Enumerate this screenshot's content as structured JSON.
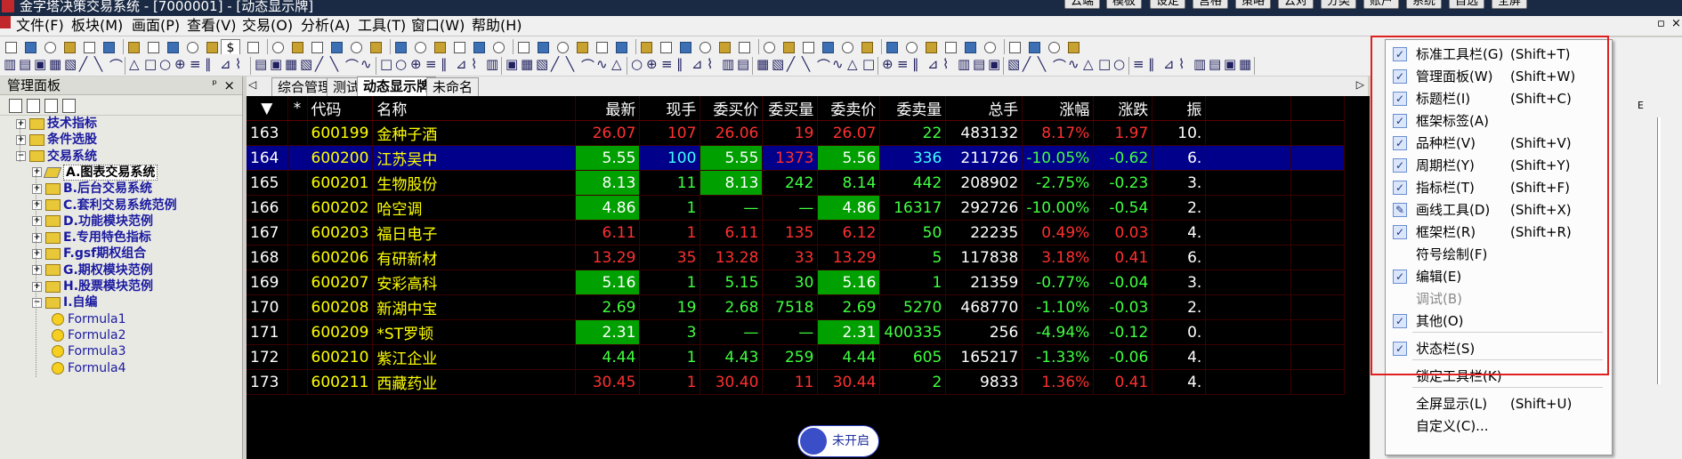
{
  "titlebar": {
    "title": "金字塔决策交易系统 - [7000001] - [动态显示牌]",
    "buttons": [
      "云端",
      "模板",
      "设定",
      "宫格",
      "策略",
      "云对",
      "分类",
      "账户",
      "系统",
      "自选",
      "全屏"
    ]
  },
  "menubar": {
    "items": [
      "文件(F)",
      "板块(M)",
      "画面(P)",
      "查看(V)",
      "交易(O)",
      "分析(A)",
      "工具(T)",
      "窗口(W)",
      "帮助(H)"
    ]
  },
  "toolbar": {
    "currency": "$"
  },
  "panel": {
    "title": "管理面板",
    "pin_glyph": "ᵖ",
    "close_glyph": "×",
    "tree": [
      {
        "label": "技术指标",
        "level": 0
      },
      {
        "label": "条件选股",
        "level": 0
      },
      {
        "label": "交易系统",
        "level": 0,
        "expanded": true
      },
      {
        "label": "A.图表交易系统",
        "level": 1,
        "selected": true
      },
      {
        "label": "B.后台交易系统",
        "level": 1
      },
      {
        "label": "C.套利交易系统范例",
        "level": 1
      },
      {
        "label": "D.功能模块范例",
        "level": 1
      },
      {
        "label": "E.专用特色指标",
        "level": 1
      },
      {
        "label": "F.gsf期权组合",
        "level": 1
      },
      {
        "label": "G.期权模块范例",
        "level": 1
      },
      {
        "label": "H.股票模块范例",
        "level": 1
      },
      {
        "label": "I.自编",
        "level": 1,
        "expanded": true
      },
      {
        "label": "Formula1",
        "level": 2
      },
      {
        "label": "Formula2",
        "level": 2
      },
      {
        "label": "Formula3",
        "level": 2
      },
      {
        "label": "Formula4",
        "level": 2
      }
    ]
  },
  "tabs": [
    "综合管理",
    "测试",
    "动态显示牌",
    "未命名"
  ],
  "active_tab": "动态显示牌",
  "grid": {
    "headers": [
      "▼",
      "*",
      "代码",
      "名称",
      "最新",
      "现手",
      "委买价",
      "委买量",
      "委卖价",
      "委卖量",
      "总手",
      "涨幅",
      "涨跌",
      "振"
    ],
    "rows": [
      {
        "idx": "163",
        "code": "600199",
        "name": "金种子酒",
        "last": "26.07",
        "vol": "107",
        "bid": "26.06",
        "bidv": "19",
        "ask": "26.07",
        "askv": "22",
        "total": "483132",
        "chg_pct": "8.17%",
        "chg": "1.97",
        "amp": "10.",
        "dir": "up"
      },
      {
        "idx": "164",
        "code": "600200",
        "name": "江苏吴中",
        "last": "5.55",
        "vol": "100",
        "bid": "5.55",
        "bidv": "1373",
        "ask": "5.56",
        "askv": "336",
        "total": "211726",
        "chg_pct": "-10.05%",
        "chg": "-0.62",
        "amp": "6.",
        "dir": "down",
        "selected": true
      },
      {
        "idx": "165",
        "code": "600201",
        "name": "生物股份",
        "last": "8.13",
        "vol": "11",
        "bid": "8.13",
        "bidv": "242",
        "ask": "8.14",
        "askv": "442",
        "total": "208902",
        "chg_pct": "-2.75%",
        "chg": "-0.23",
        "amp": "3.",
        "dir": "down"
      },
      {
        "idx": "166",
        "code": "600202",
        "name": "哈空调",
        "last": "4.86",
        "vol": "1",
        "bid": "—",
        "bidv": "—",
        "ask": "4.86",
        "askv": "16317",
        "total": "292726",
        "chg_pct": "-10.00%",
        "chg": "-0.54",
        "amp": "2.",
        "dir": "down"
      },
      {
        "idx": "167",
        "code": "600203",
        "name": "福日电子",
        "last": "6.11",
        "vol": "1",
        "bid": "6.11",
        "bidv": "135",
        "ask": "6.12",
        "askv": "50",
        "total": "22235",
        "chg_pct": "0.49%",
        "chg": "0.03",
        "amp": "4.",
        "dir": "up"
      },
      {
        "idx": "168",
        "code": "600206",
        "name": "有研新材",
        "last": "13.29",
        "vol": "35",
        "bid": "13.28",
        "bidv": "33",
        "ask": "13.29",
        "askv": "5",
        "total": "117838",
        "chg_pct": "3.18%",
        "chg": "0.41",
        "amp": "6.",
        "dir": "up"
      },
      {
        "idx": "169",
        "code": "600207",
        "name": "安彩高科",
        "last": "5.16",
        "vol": "1",
        "bid": "5.15",
        "bidv": "30",
        "ask": "5.16",
        "askv": "1",
        "total": "21359",
        "chg_pct": "-0.77%",
        "chg": "-0.04",
        "amp": "3.",
        "dir": "down"
      },
      {
        "idx": "170",
        "code": "600208",
        "name": "新湖中宝",
        "last": "2.69",
        "vol": "19",
        "bid": "2.68",
        "bidv": "7518",
        "ask": "2.69",
        "askv": "5270",
        "total": "468770",
        "chg_pct": "-1.10%",
        "chg": "-0.03",
        "amp": "2.",
        "dir": "down"
      },
      {
        "idx": "171",
        "code": "600209",
        "name": "*ST罗顿",
        "last": "2.31",
        "vol": "3",
        "bid": "—",
        "bidv": "—",
        "ask": "2.31",
        "askv": "400335",
        "total": "256",
        "chg_pct": "-4.94%",
        "chg": "-0.12",
        "amp": "0.",
        "dir": "down"
      },
      {
        "idx": "172",
        "code": "600210",
        "name": "紫江企业",
        "last": "4.44",
        "vol": "1",
        "bid": "4.43",
        "bidv": "259",
        "ask": "4.44",
        "askv": "605",
        "total": "165217",
        "chg_pct": "-1.33%",
        "chg": "-0.06",
        "amp": "4.",
        "dir": "down"
      },
      {
        "idx": "173",
        "code": "600211",
        "name": "西藏药业",
        "last": "30.45",
        "vol": "1",
        "bid": "30.40",
        "bidv": "11",
        "ask": "30.44",
        "askv": "2",
        "total": "9833",
        "chg_pct": "1.36%",
        "chg": "0.41",
        "amp": "4.",
        "dir": "up"
      }
    ]
  },
  "context_menu": {
    "items": [
      {
        "label": "标准工具栏(G)",
        "key": "(Shift+T)",
        "checked": true
      },
      {
        "label": "管理面板(W)",
        "key": "(Shift+W)",
        "checked": true
      },
      {
        "label": "标题栏(I)",
        "key": "(Shift+C)",
        "checked": true
      },
      {
        "label": "框架标签(A)",
        "key": "",
        "checked": true
      },
      {
        "label": "品种栏(V)",
        "key": "(Shift+V)",
        "checked": true
      },
      {
        "label": "周期栏(Y)",
        "key": "(Shift+Y)",
        "checked": true
      },
      {
        "label": "指标栏(T)",
        "key": "(Shift+F)",
        "checked": true
      },
      {
        "label": "画线工具(D)",
        "key": "(Shift+X)",
        "checked": true,
        "pen": true
      },
      {
        "label": "框架栏(R)",
        "key": "(Shift+R)",
        "checked": true
      },
      {
        "label": "符号绘制(F)",
        "key": "",
        "checked": false
      },
      {
        "label": "编辑(E)",
        "key": "",
        "checked": true
      },
      {
        "label": "调试(B)",
        "key": "",
        "checked": false,
        "disabled": true
      },
      {
        "label": "其他(O)",
        "key": "",
        "checked": true
      },
      {
        "label": "状态栏(S)",
        "key": "",
        "checked": true
      },
      {
        "label": "锁定工具栏(K)",
        "key": "",
        "checked": false
      },
      {
        "label": "全屏显示(L)",
        "key": "(Shift+U)",
        "checked": false
      },
      {
        "label": "自定义(C)...",
        "key": "",
        "checked": false
      }
    ]
  },
  "float_button": {
    "label": "未开启",
    "close": "×"
  },
  "colors": {
    "up": "#ff3030",
    "down": "#40ff40",
    "menu_highlight": "#e02020"
  }
}
